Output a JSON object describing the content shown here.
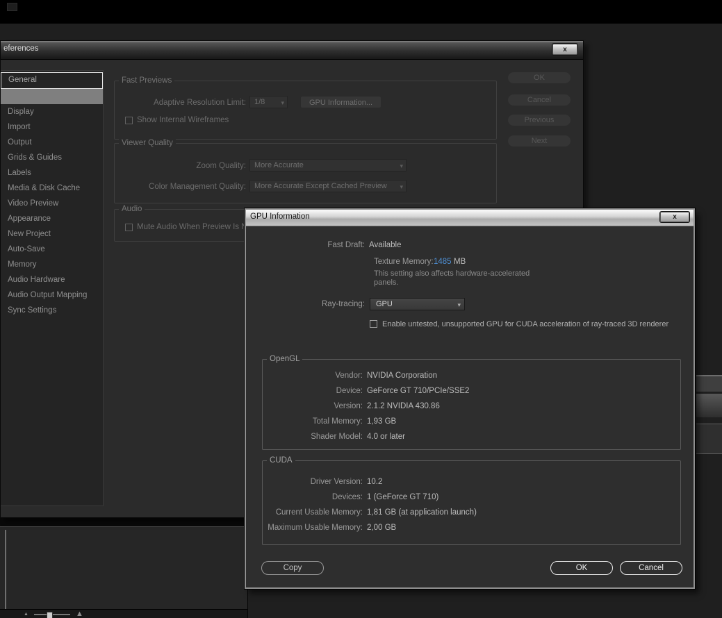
{
  "icons": {
    "close": "x",
    "chevron_down": "▾",
    "mountain": "▲"
  },
  "colors": {
    "accent_blue": "#4e8ed2",
    "selection_gray": "#7f7f7f",
    "dialog_bg": "#2e2e2e",
    "titlebar_light": "#d6d6d6"
  },
  "preferences": {
    "title": "eferences",
    "sidebar_items": [
      "General",
      "",
      "Display",
      "Import",
      "Output",
      "Grids & Guides",
      "Labels",
      "Media & Disk Cache",
      "Video Preview",
      "Appearance",
      "New Project",
      "Auto-Save",
      "Memory",
      "Audio Hardware",
      "Audio Output Mapping",
      "Sync Settings"
    ],
    "selected_index": 1,
    "fast_previews": {
      "legend": "Fast Previews",
      "adaptive_resolution_label": "Adaptive Resolution Limit:",
      "adaptive_resolution_value": "1/8",
      "gpu_information_button": "GPU Information...",
      "show_internal_wireframes_label": "Show Internal Wireframes",
      "show_internal_wireframes_checked": false
    },
    "viewer_quality": {
      "legend": "Viewer Quality",
      "zoom_quality_label": "Zoom Quality:",
      "zoom_quality_value": "More Accurate",
      "color_management_label": "Color Management Quality:",
      "color_management_value": "More Accurate Except Cached Preview"
    },
    "audio": {
      "legend": "Audio",
      "mute_audio_label": "Mute Audio When Preview Is N",
      "mute_audio_checked": false
    },
    "buttons": {
      "ok": "OK",
      "cancel": "Cancel",
      "previous": "Previous",
      "next": "Next"
    }
  },
  "gpu_dialog": {
    "title": "GPU Information",
    "fast_draft_label": "Fast Draft:",
    "fast_draft_value": "Available",
    "texture_memory_label": "Texture Memory:",
    "texture_memory_value": "1485",
    "texture_memory_unit": "MB",
    "texture_memory_note": [
      "This setting also affects hardware-accelerated",
      "panels."
    ],
    "ray_tracing_label": "Ray-tracing:",
    "ray_tracing_value": "GPU",
    "enable_untested_label": "Enable untested, unsupported GPU for CUDA acceleration of ray-traced 3D renderer",
    "enable_untested_checked": false,
    "opengl": {
      "legend": "OpenGL",
      "rows": [
        {
          "label": "Vendor:",
          "value": "NVIDIA Corporation"
        },
        {
          "label": "Device:",
          "value": "GeForce GT 710/PCIe/SSE2"
        },
        {
          "label": "Version:",
          "value": "2.1.2 NVIDIA 430.86"
        },
        {
          "label": "Total Memory:",
          "value": "1,93 GB"
        },
        {
          "label": "Shader Model:",
          "value": "4.0 or later"
        }
      ]
    },
    "cuda": {
      "legend": "CUDA",
      "rows": [
        {
          "label": "Driver Version:",
          "value": "10.2"
        },
        {
          "label": "Devices:",
          "value": "1 (GeForce GT 710)"
        },
        {
          "label": "Current Usable Memory:",
          "value": "1,81 GB (at application launch)"
        },
        {
          "label": "Maximum Usable Memory:",
          "value": "2,00 GB"
        }
      ]
    },
    "buttons": {
      "copy": "Copy",
      "ok": "OK",
      "cancel": "Cancel"
    }
  }
}
